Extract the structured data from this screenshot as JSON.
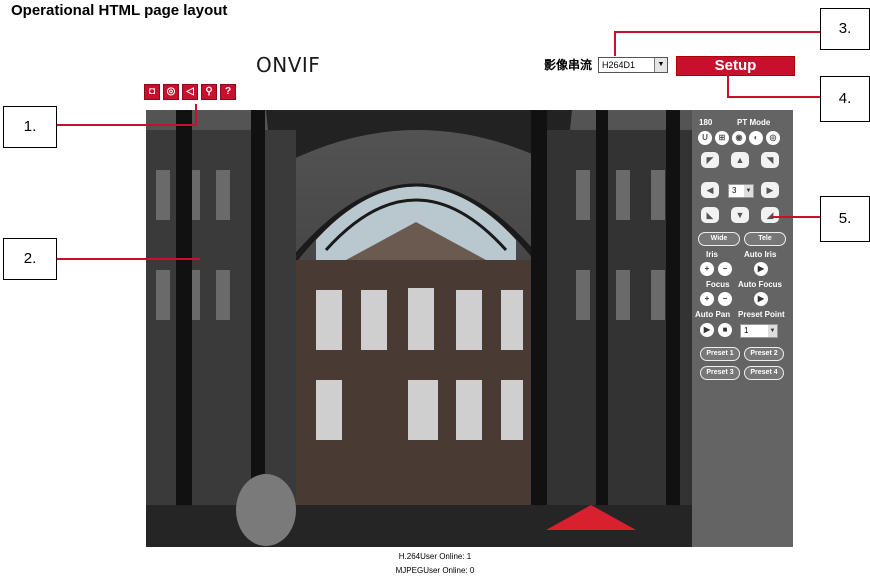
{
  "page_title": "Operational HTML page layout",
  "header": {
    "logo_text": "ONVIF",
    "stream_label": "影像串流",
    "stream_value": "H264D1",
    "setup_label": "Setup"
  },
  "toolbar": {
    "icons": [
      "snapshot-icon",
      "record-icon",
      "speaker-icon",
      "zoom-icon",
      "help-icon"
    ],
    "help_label": "?"
  },
  "control_panel": {
    "rotate_label": "180",
    "pt_mode_label": "PT Mode",
    "speed_value": "3",
    "wide_label": "Wide",
    "tele_label": "Tele",
    "iris_label": "Iris",
    "auto_iris_label": "Auto Iris",
    "focus_label": "Focus",
    "auto_focus_label": "Auto Focus",
    "auto_pan_label": "Auto Pan",
    "preset_point_label": "Preset Point",
    "preset_value": "1",
    "presets": [
      "Preset 1",
      "Preset 2",
      "Preset 3",
      "Preset 4"
    ]
  },
  "status": {
    "h264_users": "H.264User Online: 1",
    "mjpeg_users": "MJPEGUser Online: 0"
  },
  "callouts": [
    "1.",
    "2.",
    "3.",
    "4.",
    "5."
  ],
  "colors": {
    "accent": "#c8102e",
    "panel_bg": "#646464"
  }
}
